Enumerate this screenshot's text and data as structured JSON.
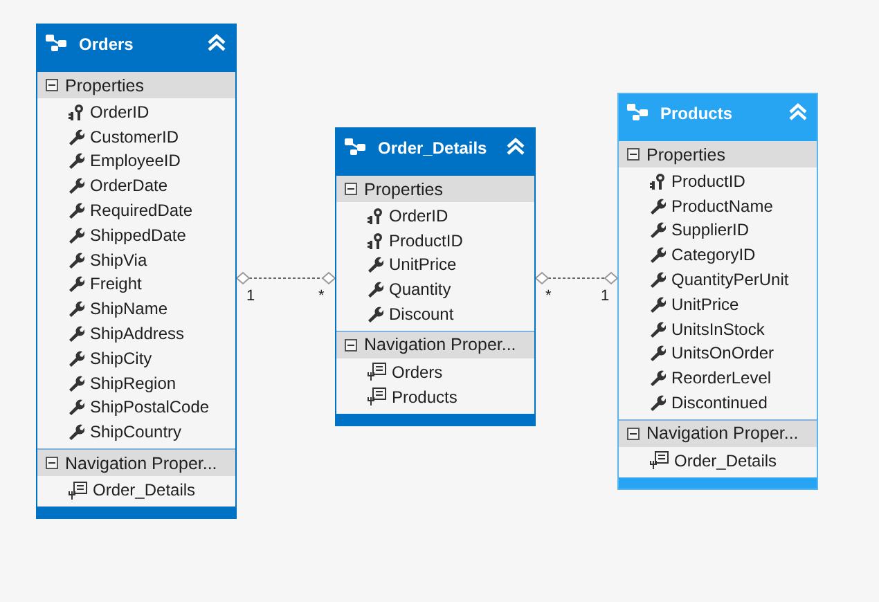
{
  "entities": [
    {
      "name": "Orders",
      "selected": false,
      "sections": [
        {
          "title": "Properties",
          "expanded": true,
          "items": [
            {
              "name": "OrderID",
              "kind": "key"
            },
            {
              "name": "CustomerID",
              "kind": "scalar"
            },
            {
              "name": "EmployeeID",
              "kind": "scalar"
            },
            {
              "name": "OrderDate",
              "kind": "scalar"
            },
            {
              "name": "RequiredDate",
              "kind": "scalar"
            },
            {
              "name": "ShippedDate",
              "kind": "scalar"
            },
            {
              "name": "ShipVia",
              "kind": "scalar"
            },
            {
              "name": "Freight",
              "kind": "scalar"
            },
            {
              "name": "ShipName",
              "kind": "scalar"
            },
            {
              "name": "ShipAddress",
              "kind": "scalar"
            },
            {
              "name": "ShipCity",
              "kind": "scalar"
            },
            {
              "name": "ShipRegion",
              "kind": "scalar"
            },
            {
              "name": "ShipPostalCode",
              "kind": "scalar"
            },
            {
              "name": "ShipCountry",
              "kind": "scalar"
            }
          ]
        },
        {
          "title": "Navigation Proper...",
          "expanded": true,
          "items": [
            {
              "name": "Order_Details",
              "kind": "navigation"
            }
          ]
        }
      ]
    },
    {
      "name": "Order_Details",
      "selected": false,
      "sections": [
        {
          "title": "Properties",
          "expanded": true,
          "items": [
            {
              "name": "OrderID",
              "kind": "key"
            },
            {
              "name": "ProductID",
              "kind": "key"
            },
            {
              "name": "UnitPrice",
              "kind": "scalar"
            },
            {
              "name": "Quantity",
              "kind": "scalar"
            },
            {
              "name": "Discount",
              "kind": "scalar"
            }
          ]
        },
        {
          "title": "Navigation Proper...",
          "expanded": true,
          "items": [
            {
              "name": "Orders",
              "kind": "navigation"
            },
            {
              "name": "Products",
              "kind": "navigation"
            }
          ]
        }
      ]
    },
    {
      "name": "Products",
      "selected": true,
      "sections": [
        {
          "title": "Properties",
          "expanded": true,
          "items": [
            {
              "name": "ProductID",
              "kind": "key"
            },
            {
              "name": "ProductName",
              "kind": "scalar"
            },
            {
              "name": "SupplierID",
              "kind": "scalar"
            },
            {
              "name": "CategoryID",
              "kind": "scalar"
            },
            {
              "name": "QuantityPerUnit",
              "kind": "scalar"
            },
            {
              "name": "UnitPrice",
              "kind": "scalar"
            },
            {
              "name": "UnitsInStock",
              "kind": "scalar"
            },
            {
              "name": "UnitsOnOrder",
              "kind": "scalar"
            },
            {
              "name": "ReorderLevel",
              "kind": "scalar"
            },
            {
              "name": "Discontinued",
              "kind": "scalar"
            }
          ]
        },
        {
          "title": "Navigation Proper...",
          "expanded": true,
          "items": [
            {
              "name": "Order_Details",
              "kind": "navigation"
            }
          ]
        }
      ]
    }
  ],
  "associations": [
    {
      "from_multiplicity": "1",
      "to_multiplicity": "*"
    },
    {
      "from_multiplicity": "*",
      "to_multiplicity": "1"
    }
  ]
}
